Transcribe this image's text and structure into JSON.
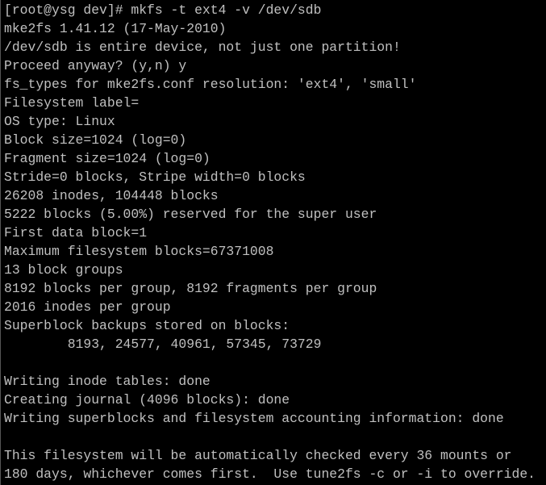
{
  "terminal": {
    "text_color": "#c0c0c0",
    "background_color": "#000000",
    "lines": [
      "[root@ysg dev]# mkfs -t ext4 -v /dev/sdb",
      "mke2fs 1.41.12 (17-May-2010)",
      "/dev/sdb is entire device, not just one partition!",
      "Proceed anyway? (y,n) y",
      "fs_types for mke2fs.conf resolution: 'ext4', 'small'",
      "Filesystem label=",
      "OS type: Linux",
      "Block size=1024 (log=0)",
      "Fragment size=1024 (log=0)",
      "Stride=0 blocks, Stripe width=0 blocks",
      "26208 inodes, 104448 blocks",
      "5222 blocks (5.00%) reserved for the super user",
      "First data block=1",
      "Maximum filesystem blocks=67371008",
      "13 block groups",
      "8192 blocks per group, 8192 fragments per group",
      "2016 inodes per group",
      "Superblock backups stored on blocks:",
      "        8193, 24577, 40961, 57345, 73729",
      "",
      "Writing inode tables: done",
      "Creating journal (4096 blocks): done",
      "Writing superblocks and filesystem accounting information: done",
      "",
      "This filesystem will be automatically checked every 36 mounts or",
      "180 days, whichever comes first.  Use tune2fs -c or -i to override."
    ]
  }
}
